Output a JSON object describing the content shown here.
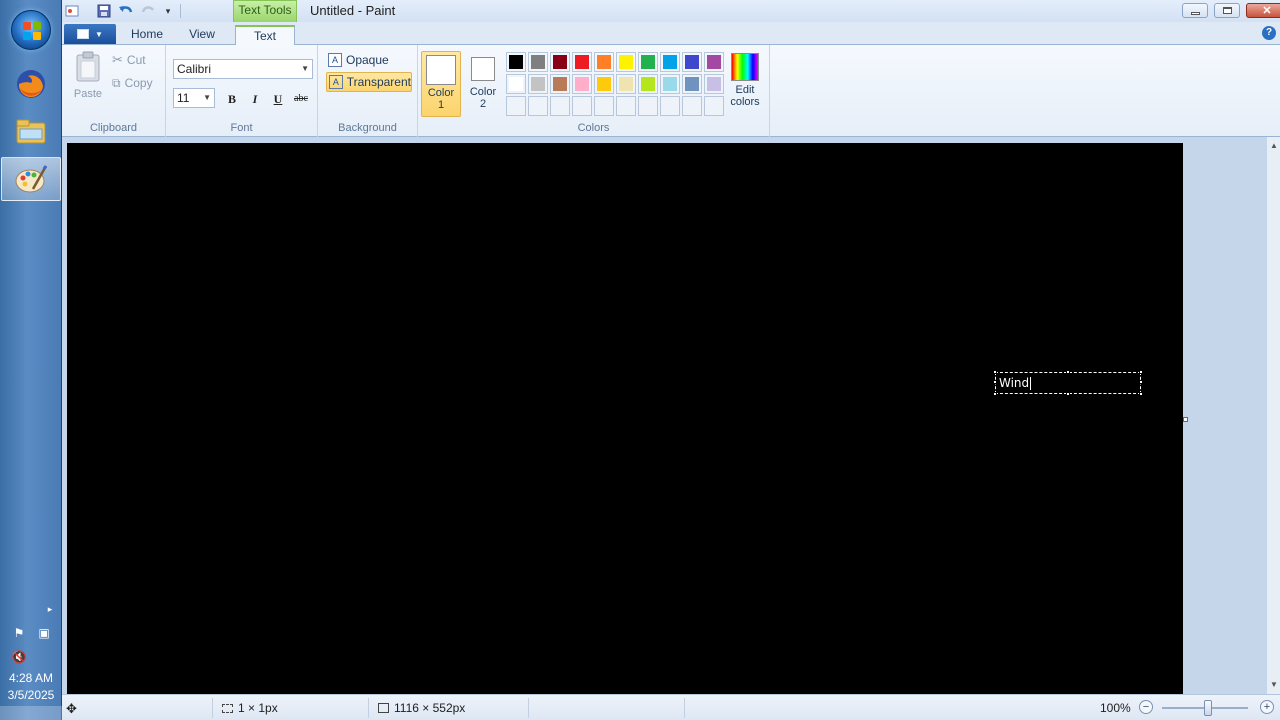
{
  "window": {
    "title": "Untitled - Paint",
    "context_tab": "Text Tools"
  },
  "tabs": [
    {
      "label": "Home"
    },
    {
      "label": "View"
    },
    {
      "label": "Text"
    }
  ],
  "clipboard": {
    "paste": "Paste",
    "cut": "Cut",
    "copy": "Copy",
    "group_label": "Clipboard"
  },
  "font": {
    "family": "Calibri",
    "size": "11",
    "bold": "B",
    "italic": "I",
    "underline": "U",
    "strike": "abc",
    "group_label": "Font"
  },
  "background": {
    "opaque": "Opaque",
    "transparent": "Transparent",
    "group_label": "Background",
    "selected": "Transparent"
  },
  "colors": {
    "color1_label": "Color",
    "color1_num": "1",
    "color2_label": "Color",
    "color2_num": "2",
    "edit_label": "Edit",
    "edit_label2": "colors",
    "group_label": "Colors",
    "color1_value": "#ffffff",
    "color2_value": "#ffffff",
    "palette_row1": [
      "#000000",
      "#7f7f7f",
      "#880015",
      "#ed1c24",
      "#ff7f27",
      "#fff200",
      "#22b14c",
      "#00a2e8",
      "#3f48cc",
      "#a349a4"
    ],
    "palette_row2": [
      "#ffffff",
      "#c3c3c3",
      "#b97a57",
      "#ffaec9",
      "#ffc90e",
      "#efe4b0",
      "#b5e61d",
      "#99d9ea",
      "#7092be",
      "#c8bfe7"
    ]
  },
  "canvas": {
    "background": "#000000",
    "text": "Wind"
  },
  "status": {
    "cursor_size": "1 × 1px",
    "canvas_size": "1116 × 552px",
    "zoom": "100%"
  },
  "tray": {
    "time": "4:28 AM",
    "date": "3/5/2025"
  }
}
